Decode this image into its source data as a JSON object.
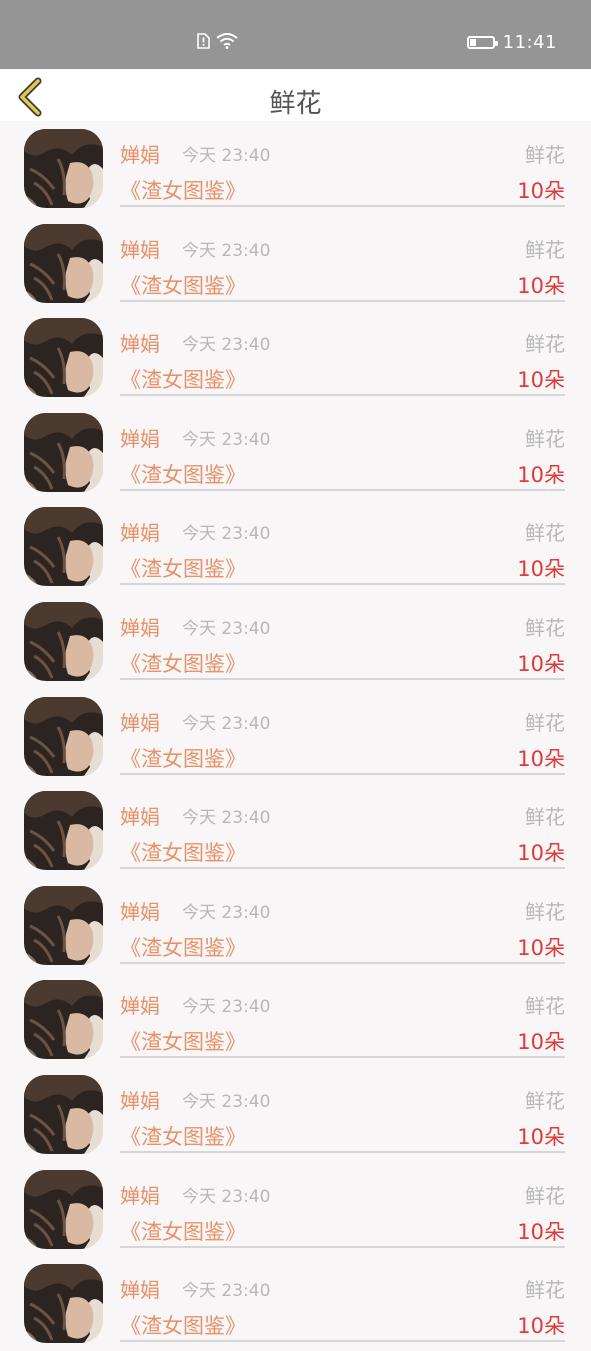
{
  "status_bar": {
    "time": "11:41",
    "battery_level": 0.3
  },
  "nav": {
    "title": "鲜花"
  },
  "records": [
    {
      "name": "婵娟",
      "time": "今天 23:40",
      "gift": "鲜花",
      "book": "《渣女图鉴》",
      "count": "10朵"
    },
    {
      "name": "婵娟",
      "time": "今天 23:40",
      "gift": "鲜花",
      "book": "《渣女图鉴》",
      "count": "10朵"
    },
    {
      "name": "婵娟",
      "time": "今天 23:40",
      "gift": "鲜花",
      "book": "《渣女图鉴》",
      "count": "10朵"
    },
    {
      "name": "婵娟",
      "time": "今天 23:40",
      "gift": "鲜花",
      "book": "《渣女图鉴》",
      "count": "10朵"
    },
    {
      "name": "婵娟",
      "time": "今天 23:40",
      "gift": "鲜花",
      "book": "《渣女图鉴》",
      "count": "10朵"
    },
    {
      "name": "婵娟",
      "time": "今天 23:40",
      "gift": "鲜花",
      "book": "《渣女图鉴》",
      "count": "10朵"
    },
    {
      "name": "婵娟",
      "time": "今天 23:40",
      "gift": "鲜花",
      "book": "《渣女图鉴》",
      "count": "10朵"
    },
    {
      "name": "婵娟",
      "time": "今天 23:40",
      "gift": "鲜花",
      "book": "《渣女图鉴》",
      "count": "10朵"
    },
    {
      "name": "婵娟",
      "time": "今天 23:40",
      "gift": "鲜花",
      "book": "《渣女图鉴》",
      "count": "10朵"
    },
    {
      "name": "婵娟",
      "time": "今天 23:40",
      "gift": "鲜花",
      "book": "《渣女图鉴》",
      "count": "10朵"
    },
    {
      "name": "婵娟",
      "time": "今天 23:40",
      "gift": "鲜花",
      "book": "《渣女图鉴》",
      "count": "10朵"
    },
    {
      "name": "婵娟",
      "time": "今天 23:40",
      "gift": "鲜花",
      "book": "《渣女图鉴》",
      "count": "10朵"
    },
    {
      "name": "婵娟",
      "time": "今天 23:40",
      "gift": "鲜花",
      "book": "《渣女图鉴》",
      "count": "10朵"
    }
  ],
  "colors": {
    "status_bar": "#959595",
    "accent_orange": "#e8926a",
    "count_red": "#e03a3a",
    "back_arrow": "#e3c84a"
  }
}
